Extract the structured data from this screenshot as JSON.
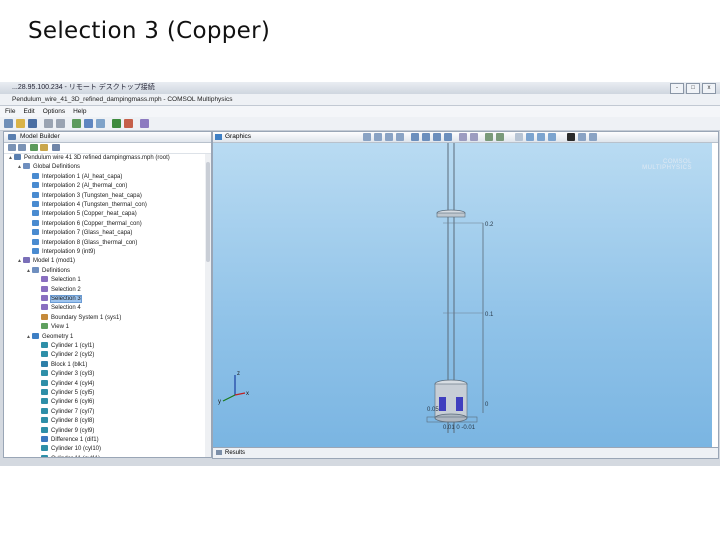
{
  "slide": {
    "title": "Selection 3 (Copper)"
  },
  "window": {
    "remote_title": "...28.95.100.234 - リモート デスクトップ接続",
    "app_title": "Pendulum_wire_41_3D_refined_dampingmass.mph - COMSOL Multiphysics",
    "buttons": [
      "-",
      "□",
      "x"
    ]
  },
  "menu": [
    "File",
    "Edit",
    "Options",
    "Help"
  ],
  "model_builder": {
    "tab_label": "Model Builder",
    "tree": [
      {
        "label": "Pendulum wire 41 3D refined dampingmass.mph (root)",
        "depth": 0,
        "icon": "file-icon"
      },
      {
        "label": "Global Definitions",
        "depth": 1,
        "icon": "folder-icon"
      },
      {
        "label": "Interpolation 1 (Al_heat_capa)",
        "depth": 2,
        "icon": "interp-icon"
      },
      {
        "label": "Interpolation 2 (Al_thermal_con)",
        "depth": 2,
        "icon": "interp-icon"
      },
      {
        "label": "Interpolation 3 (Tungsten_heat_capa)",
        "depth": 2,
        "icon": "interp-icon"
      },
      {
        "label": "Interpolation 4 (Tungsten_thermal_con)",
        "depth": 2,
        "icon": "interp-icon"
      },
      {
        "label": "Interpolation 5 (Copper_heat_capa)",
        "depth": 2,
        "icon": "interp-icon"
      },
      {
        "label": "Interpolation 6 (Copper_thermal_con)",
        "depth": 2,
        "icon": "interp-icon"
      },
      {
        "label": "Interpolation 7 (Glass_heat_capa)",
        "depth": 2,
        "icon": "interp-icon"
      },
      {
        "label": "Interpolation 8 (Glass_thermal_con)",
        "depth": 2,
        "icon": "interp-icon"
      },
      {
        "label": "Interpolation 9 (int9)",
        "depth": 2,
        "icon": "interp-icon"
      },
      {
        "label": "Model 1 (mod1)",
        "depth": 1,
        "icon": "model-icon"
      },
      {
        "label": "Definitions",
        "depth": 2,
        "icon": "folder-icon"
      },
      {
        "label": "Selection 1",
        "depth": 3,
        "icon": "selection-icon"
      },
      {
        "label": "Selection 2",
        "depth": 3,
        "icon": "selection-icon"
      },
      {
        "label": "Selection 3",
        "depth": 3,
        "icon": "selection-icon",
        "selected": true
      },
      {
        "label": "Selection 4",
        "depth": 3,
        "icon": "selection-icon"
      },
      {
        "label": "Boundary System 1 (sys1)",
        "depth": 3,
        "icon": "axis-icon"
      },
      {
        "label": "View 1",
        "depth": 3,
        "icon": "view-icon"
      },
      {
        "label": "Geometry 1",
        "depth": 2,
        "icon": "geometry-icon"
      },
      {
        "label": "Cylinder 1 (cyl1)",
        "depth": 3,
        "icon": "cylinder-icon"
      },
      {
        "label": "Cylinder 2 (cyl2)",
        "depth": 3,
        "icon": "cylinder-icon"
      },
      {
        "label": "Block 1 (blk1)",
        "depth": 3,
        "icon": "block-icon"
      },
      {
        "label": "Cylinder 3 (cyl3)",
        "depth": 3,
        "icon": "cylinder-icon"
      },
      {
        "label": "Cylinder 4 (cyl4)",
        "depth": 3,
        "icon": "cylinder-icon"
      },
      {
        "label": "Cylinder 5 (cyl5)",
        "depth": 3,
        "icon": "cylinder-icon"
      },
      {
        "label": "Cylinder 6 (cyl6)",
        "depth": 3,
        "icon": "cylinder-icon"
      },
      {
        "label": "Cylinder 7 (cyl7)",
        "depth": 3,
        "icon": "cylinder-icon"
      },
      {
        "label": "Cylinder 8 (cyl8)",
        "depth": 3,
        "icon": "cylinder-icon"
      },
      {
        "label": "Cylinder 9 (cyl9)",
        "depth": 3,
        "icon": "cylinder-icon"
      },
      {
        "label": "Difference 1 (dif1)",
        "depth": 3,
        "icon": "difference-icon"
      },
      {
        "label": "Cylinder 10 (cyl10)",
        "depth": 3,
        "icon": "cylinder-icon"
      },
      {
        "label": "Cylinder 11 (cyl11)",
        "depth": 3,
        "icon": "cylinder-icon"
      }
    ]
  },
  "graphics": {
    "tab_label": "Graphics",
    "logo_line1": "COMSOL",
    "logo_line2": "MULTIPHYSICS",
    "ruler_labels": [
      "0.2",
      "0.1",
      "0"
    ],
    "axes": {
      "z": "z",
      "y": "y",
      "x": "x"
    },
    "bottom_labels": [
      "0.05",
      "0.01 0 -0.01"
    ]
  },
  "results": {
    "tab_label": "Results"
  },
  "colors": {
    "canvas_top": "#b9dbf2",
    "canvas_bottom": "#7ab5e2",
    "selection_highlight": "#9cc3ee",
    "copper_part": "#3f3fbf"
  }
}
